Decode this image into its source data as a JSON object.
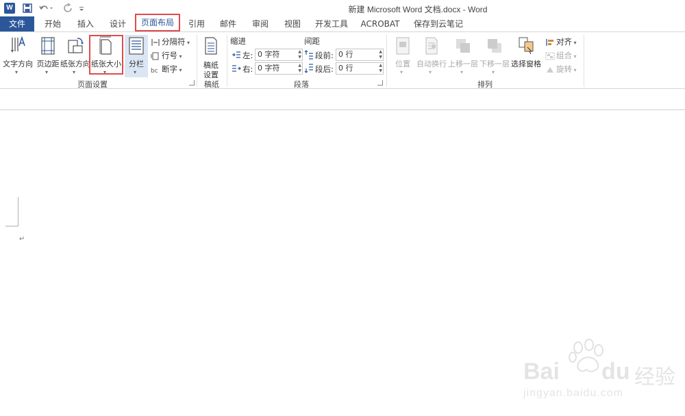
{
  "title_bar": {
    "doc_title": "新建 Microsoft Word 文档.docx - Word",
    "app_logo": "W"
  },
  "tabs": [
    "文件",
    "开始",
    "插入",
    "设计",
    "页面布局",
    "引用",
    "邮件",
    "审阅",
    "视图",
    "开发工具",
    "ACROBAT",
    "保存到云笔记"
  ],
  "active_tab": "页面布局",
  "highlight_color": "#e04a4a",
  "accent_color": "#2b579a",
  "ribbon": {
    "page_setup": {
      "label": "页面设置",
      "text_direction": "文字方向",
      "margins": "页边距",
      "orientation": "纸张方向",
      "size": "纸张大小",
      "columns": "分栏",
      "breaks": "分隔符",
      "line_numbers": "行号",
      "hyphenation": "断字"
    },
    "manuscript": {
      "label": "稿纸",
      "settings_line1": "稿纸",
      "settings_line2": "设置"
    },
    "paragraph": {
      "label": "段落",
      "indent_header": "缩进",
      "spacing_header": "间距",
      "left_label": "左:",
      "right_label": "右:",
      "before_label": "段前:",
      "after_label": "段后:",
      "left_value": "0 字符",
      "right_value": "0 字符",
      "before_value": "0 行",
      "after_value": "0 行"
    },
    "arrange": {
      "label": "排列",
      "position": "位置",
      "wrap_text": "自动换行",
      "bring_forward": "上移一层",
      "send_backward": "下移一层",
      "selection_pane": "选择窗格",
      "align": "对齐",
      "group": "组合",
      "rotate": "旋转"
    }
  },
  "document": {
    "paragraph_mark": "↵"
  },
  "watermark": {
    "brand": "Bai",
    "brand2": "du",
    "cn": "经验",
    "url": "jingyan.baidu.com"
  }
}
